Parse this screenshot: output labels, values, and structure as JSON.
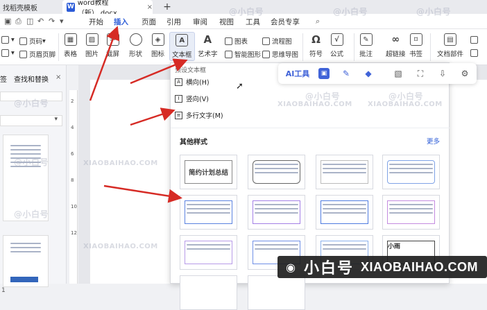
{
  "titlebar": {
    "tab_templates": "找稻壳模板",
    "doc_tab": "word教程（新）.docx",
    "w_badge": "W",
    "close": "×",
    "add": "+"
  },
  "menubar": {
    "items": [
      "开始",
      "插入",
      "页面",
      "引用",
      "审阅",
      "视图",
      "工具",
      "会员专享"
    ],
    "active": "插入"
  },
  "ribbon": {
    "left_small": [
      "页码",
      "页眉页脚"
    ],
    "buttons": [
      "表格",
      "图片",
      "截屏",
      "形状",
      "图标",
      "文本框",
      "艺术字",
      "图表",
      "智能图形",
      "流程图",
      "思维导图",
      "符号",
      "公式",
      "批注",
      "超链接",
      "书签",
      "文档部件"
    ],
    "textbox_icon_text": "A"
  },
  "left_panel": {
    "tab_a": "签",
    "tab_b": "查找和替换",
    "close": "×",
    "page_number": "1"
  },
  "vruler": {
    "marks": [
      "2",
      "4",
      "6",
      "8",
      "10",
      "12"
    ]
  },
  "textbox_dropdown": {
    "header": "预设文本框",
    "options": [
      "横向(H)",
      "竖向(V)",
      "多行文字(M)"
    ],
    "section_title": "其他样式",
    "more": "更多",
    "card1_title": "简约计划总结",
    "card8_text": "小雨"
  },
  "ai_toolbar": {
    "label": "AI工具"
  },
  "watermark": {
    "cn": "@小白号",
    "en": "XIAOBAIHAO.COM"
  },
  "brand": {
    "cn": "小白号",
    "en": "XIAOBAIHAO.COM"
  },
  "colors": {
    "accent": "#2b5bd7",
    "arrow": "#d62b25",
    "brand_bg": "#1e1e1e"
  }
}
